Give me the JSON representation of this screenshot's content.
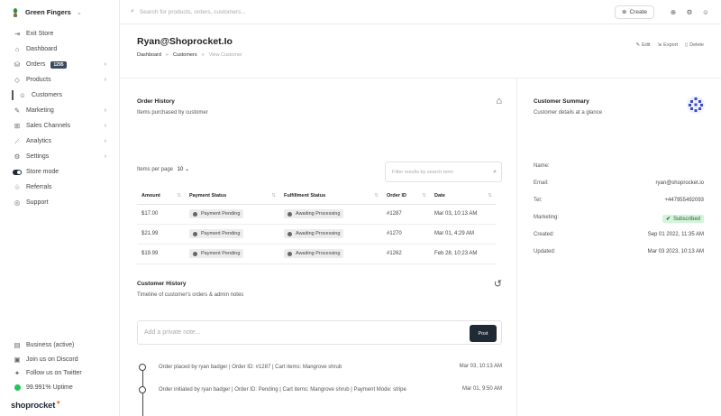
{
  "brand": {
    "name": "Green Fingers",
    "chevron": "⌄"
  },
  "sidebar": {
    "items": [
      {
        "label": "Exit Store",
        "icon": "exit-icon"
      },
      {
        "label": "Dashboard",
        "icon": "dashboard-icon"
      },
      {
        "label": "Orders",
        "icon": "orders-icon",
        "badge": "1295"
      },
      {
        "label": "Products",
        "icon": "products-icon"
      },
      {
        "label": "Customers",
        "icon": "customers-icon"
      },
      {
        "label": "Marketing",
        "icon": "marketing-icon"
      },
      {
        "label": "Sales Channels",
        "icon": "sales-channels-icon"
      },
      {
        "label": "Analytics",
        "icon": "analytics-icon"
      },
      {
        "label": "Settings",
        "icon": "settings-icon"
      },
      {
        "label": "Store mode",
        "icon": "toggle-icon"
      },
      {
        "label": "Referrals",
        "icon": "referrals-icon"
      },
      {
        "label": "Support",
        "icon": "support-icon"
      }
    ],
    "bottom": [
      {
        "label": "Business (active)",
        "icon": "business-icon"
      },
      {
        "label": "Join us on Discord",
        "icon": "discord-icon"
      },
      {
        "label": "Follow us on Twitter",
        "icon": "twitter-icon"
      },
      {
        "label": "99.991% Uptime",
        "icon": "status-dot-icon"
      }
    ],
    "logo": "shoprocket"
  },
  "topbar": {
    "search_placeholder": "Search for products, orders, customers...",
    "create_label": "Create"
  },
  "page": {
    "title": "Ryan@Shoprocket.Io",
    "breadcrumb": [
      "Dashboard",
      "Customers",
      "View Customer"
    ],
    "actions": {
      "edit": "Edit",
      "export": "Export",
      "delete": "Delete"
    }
  },
  "order_history": {
    "title": "Order History",
    "subtitle": "Items purchased by customer",
    "items_per_page_label": "Items per page",
    "items_per_page_value": "10",
    "filter_placeholder": "Filter results by search term",
    "columns": [
      "Amount",
      "Payment Status",
      "Fulfillment Status",
      "Order ID",
      "Date"
    ],
    "rows": [
      {
        "amount": "$17.00",
        "payment": "Payment Pending",
        "fulfillment": "Awaiting Processing",
        "order_id": "#1287",
        "date": "Mar 03, 10:13 AM"
      },
      {
        "amount": "$21.99",
        "payment": "Payment Pending",
        "fulfillment": "Awaiting Processing",
        "order_id": "#1270",
        "date": "Mar 01, 4:29 AM"
      },
      {
        "amount": "$19.99",
        "payment": "Payment Pending",
        "fulfillment": "Awaiting Processing",
        "order_id": "#1262",
        "date": "Feb 28, 10:23 AM"
      }
    ]
  },
  "customer_history": {
    "title": "Customer History",
    "subtitle": "Timeline of customer's orders & admin notes",
    "note_placeholder": "Add a private note...",
    "post_label": "Post",
    "events": [
      {
        "text": "Order placed by ryan badger | Order ID: #1287 | Cart items: Mangrove shrub",
        "date": "Mar 03, 10:13 AM"
      },
      {
        "text": "Order initiated by ryan badger | Order ID: Pending | Cart items: Mangrove shrub | Payment Mode: stripe",
        "date": "Mar 01, 9:50 AM"
      }
    ]
  },
  "customer_summary": {
    "title": "Customer Summary",
    "subtitle": "Customer details at a glance",
    "rows": [
      {
        "label": "Name:",
        "value": ""
      },
      {
        "label": "Email:",
        "value": "ryan@shoprocket.io"
      },
      {
        "label": "Tel:",
        "value": "+447955492093"
      },
      {
        "label": "Marketing:",
        "value": "Subscribed"
      },
      {
        "label": "Created:",
        "value": "Sep 01 2022, 11:35 AM"
      },
      {
        "label": "Updated:",
        "value": "Mar 03 2023, 10:13 AM"
      }
    ]
  },
  "colors": {
    "accent_dark": "#1f2a36",
    "success_bg": "#d6f2dc",
    "uptime": "#22c55e",
    "logo_spark": "#e86b1a"
  }
}
